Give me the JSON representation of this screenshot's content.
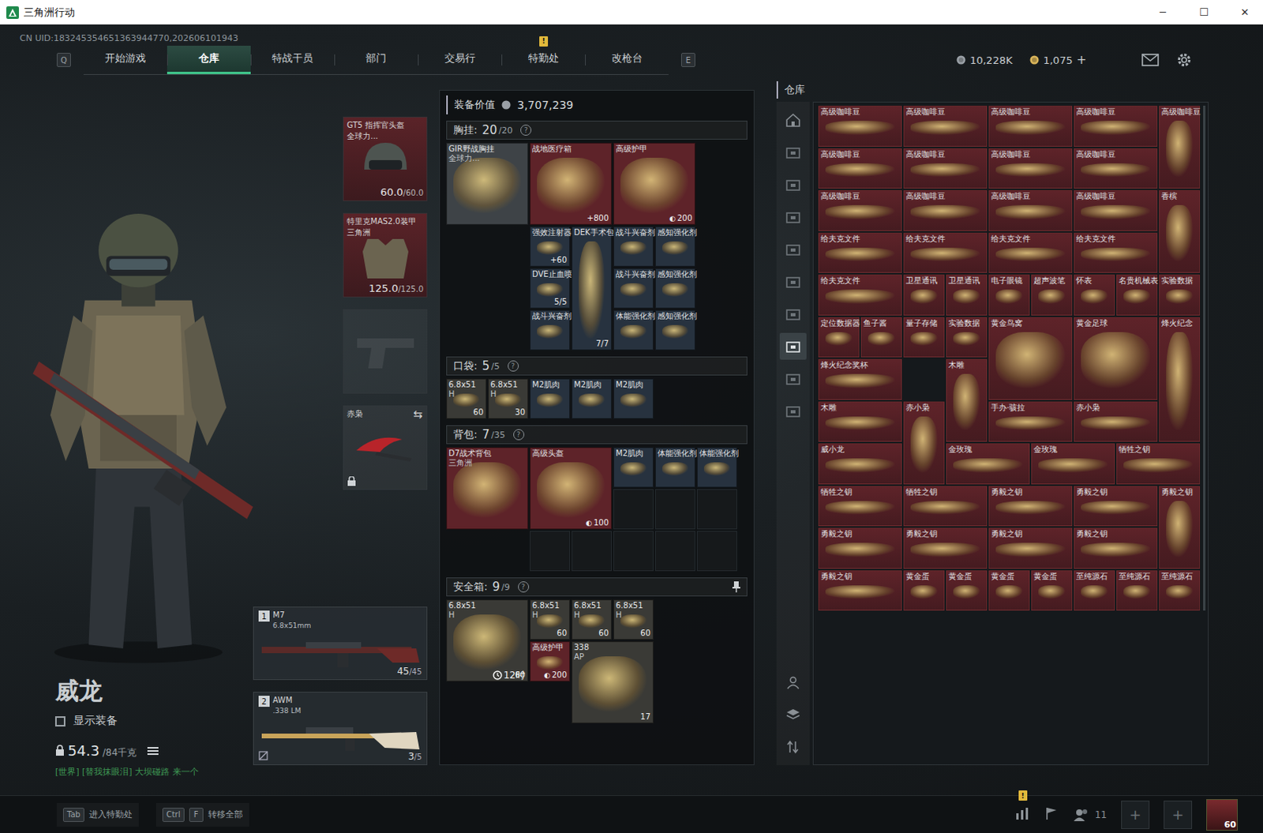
{
  "window": {
    "title": "三角洲行动",
    "controls": [
      "─",
      "☐",
      "✕"
    ]
  },
  "uid": "CN UID:183245354651363944770,202606101943",
  "nav": {
    "prev_key": "Q",
    "next_key": "E",
    "alert_mark": "!",
    "tabs": [
      {
        "label": "开始游戏",
        "selected": false,
        "alert": false
      },
      {
        "label": "仓库",
        "selected": true,
        "alert": false
      },
      {
        "label": "特战干员",
        "selected": false,
        "alert": false
      },
      {
        "label": "部门",
        "selected": false,
        "alert": false
      },
      {
        "label": "交易行",
        "selected": false,
        "alert": false
      },
      {
        "label": "特勤处",
        "selected": false,
        "alert": true
      },
      {
        "label": "改枪台",
        "selected": false,
        "alert": false
      }
    ]
  },
  "currencies": [
    {
      "value": "10,228K",
      "add": "",
      "color": "#9aa0a6"
    },
    {
      "value": "1,075",
      "add": "+",
      "color": "#d9b45a"
    }
  ],
  "operator": {
    "name": "威龙",
    "show_equipment": {
      "label": "显示装备",
      "checked": false
    },
    "weight": "54.3",
    "weight_max": "/84千克",
    "chat": "[世界] [替我抹眼泪] 大坝碰路 来一个"
  },
  "gear_slots": [
    {
      "kind": "helmet",
      "name": "GT5 指挥官头盔",
      "sub": "全球力...",
      "value": "60.0",
      "max": "/60.0"
    },
    {
      "kind": "armor",
      "name": "特里克MAS2.0装甲",
      "sub": "三角洲",
      "value": "125.0",
      "max": "/125.0"
    },
    {
      "kind": "pistol"
    },
    {
      "kind": "melee",
      "name": "赤枭",
      "swap": "⇆"
    }
  ],
  "weapons": [
    {
      "slot": "1",
      "name": "M7",
      "caliber": "6.8x51mm",
      "ammo": "45",
      "max": "/45"
    },
    {
      "slot": "2",
      "name": "AWM",
      "caliber": ".338 LM",
      "ammo": "3",
      "max": "/5"
    }
  ],
  "loadout": {
    "value_label": "装备价值",
    "value": "3,707,239",
    "help": "?",
    "chest": {
      "title": "胸挂:",
      "count": "20",
      "max": "/20",
      "items": [
        {
          "label": "GIR野战胸挂",
          "sub": "全球力...",
          "count": "",
          "color": "#3e4347"
        },
        {
          "label": "战地医疗箱",
          "sub": "",
          "count": "+800",
          "color": "#5e2329"
        },
        {
          "label": "高级护甲",
          "sub": "",
          "count": "200",
          "count_icon": "◐",
          "color": "#5e2329"
        },
        {
          "label": "强效注射器",
          "sub": "",
          "count": "+60",
          "color": "#27323f"
        },
        {
          "label": "DVE止血喷",
          "sub": "",
          "count": "5/5",
          "color": "#27323f"
        },
        {
          "label": "战斗兴奋剂",
          "sub": "",
          "count": "",
          "color": "#27323f"
        },
        {
          "label": "DEK手术包",
          "sub": "",
          "count": "7/7",
          "color": "#27323f"
        },
        {
          "label": "战斗兴奋剂",
          "sub": "",
          "count": "",
          "color": "#27323f"
        },
        {
          "label": "战斗兴奋剂",
          "sub": "",
          "count": "",
          "color": "#27323f"
        },
        {
          "label": "体能强化剂",
          "sub": "",
          "count": "",
          "color": "#27323f"
        },
        {
          "label": "感知强化剂",
          "sub": "",
          "count": "",
          "color": "#27323f"
        },
        {
          "label": "感知强化剂",
          "sub": "",
          "count": "",
          "color": "#27323f"
        },
        {
          "label": "感知强化剂",
          "sub": "",
          "count": "",
          "color": "#27323f"
        }
      ]
    },
    "pocket": {
      "title": "口袋:",
      "count": "5",
      "max": "/5",
      "items": [
        {
          "label": "6.8x51",
          "sub": "H",
          "count": "60",
          "color": "#3a3a36"
        },
        {
          "label": "6.8x51",
          "sub": "H",
          "count": "30",
          "color": "#3a3a36"
        },
        {
          "label": "M2肌肉",
          "sub": "",
          "count": "",
          "color": "#27323f"
        },
        {
          "label": "M2肌肉",
          "sub": "",
          "count": "",
          "color": "#27323f"
        },
        {
          "label": "M2肌肉",
          "sub": "",
          "count": "",
          "color": "#27323f"
        }
      ]
    },
    "backpack": {
      "title": "背包:",
      "count": "7",
      "max": "/35",
      "items": [
        {
          "label": "D7战术背包",
          "sub": "三角洲",
          "count": "",
          "color": "#5e2329"
        },
        {
          "label": "高级头盔",
          "sub": "",
          "count": "100",
          "count_icon": "◐",
          "color": "#5e2329"
        },
        {
          "label": "M2肌肉",
          "sub": "",
          "count": "",
          "color": "#27323f"
        },
        {
          "label": "体能强化剂",
          "sub": "",
          "count": "",
          "color": "#27323f"
        },
        {
          "label": "体能强化剂",
          "sub": "",
          "count": "",
          "color": "#27323f"
        }
      ]
    },
    "safebox": {
      "title": "安全箱:",
      "count": "9",
      "max": "/9",
      "timer": "12时",
      "items": [
        {
          "label": "6.8x51",
          "sub": "H",
          "count": "60",
          "color": "#3a3a36"
        },
        {
          "label": "6.8x51",
          "sub": "H",
          "count": "60",
          "color": "#3a3a36"
        },
        {
          "label": "6.8x51",
          "sub": "H",
          "count": "60",
          "color": "#3a3a36"
        },
        {
          "label": "6.8x51",
          "sub": "H",
          "count": "60",
          "color": "#3a3a36"
        },
        {
          "label": "高级护甲",
          "sub": "",
          "count": "200",
          "count_icon": "◐",
          "color": "#5e2329"
        },
        {
          "label": "338",
          "sub": "AP",
          "count": "17",
          "color": "#3a3a36"
        }
      ]
    }
  },
  "warehouse": {
    "title": "仓库",
    "side_tabs": [
      {
        "selected": false
      },
      {
        "selected": false
      },
      {
        "selected": false
      },
      {
        "selected": false
      },
      {
        "selected": false
      },
      {
        "selected": false
      },
      {
        "selected": false
      },
      {
        "selected": true
      },
      {
        "selected": false
      },
      {
        "selected": false
      }
    ],
    "items": [
      {
        "label": "高级咖啡豆"
      },
      {
        "label": "高级咖啡豆"
      },
      {
        "label": "高级咖啡豆"
      },
      {
        "label": "高级咖啡豆"
      },
      {
        "label": "高级咖啡豆"
      },
      {
        "label": "高级咖啡豆"
      },
      {
        "label": "高级咖啡豆"
      },
      {
        "label": "高级咖啡豆"
      },
      {
        "label": "高级咖啡豆"
      },
      {
        "label": "高级咖啡豆"
      },
      {
        "label": "高级咖啡豆"
      },
      {
        "label": "高级咖啡豆"
      },
      {
        "label": "高级咖啡豆"
      },
      {
        "label": "香槟"
      },
      {
        "label": "给夫克文件"
      },
      {
        "label": "给夫克文件"
      },
      {
        "label": "给夫克文件"
      },
      {
        "label": "给夫克文件"
      },
      {
        "label": "给夫克文件"
      },
      {
        "label": "卫星通讯"
      },
      {
        "label": "卫星通讯"
      },
      {
        "label": "电子眼镜"
      },
      {
        "label": "超声波笔"
      },
      {
        "label": "怀表"
      },
      {
        "label": "名贵机械表"
      },
      {
        "label": "实验数据"
      },
      {
        "label": "定位数据器"
      },
      {
        "label": "鱼子酱"
      },
      {
        "label": "量子存储"
      },
      {
        "label": "实验数据"
      },
      {
        "label": "黄金鸟窝"
      },
      {
        "label": "黄金足球"
      },
      {
        "label": "烽火纪念"
      },
      {
        "label": "烽火纪念奖杯"
      },
      {
        "label": "木雕"
      },
      {
        "label": "木雕"
      },
      {
        "label": "赤小枭"
      },
      {
        "label": "手办·骇拉"
      },
      {
        "label": "赤小枭"
      },
      {
        "label": "威小龙"
      },
      {
        "label": "金玫瑰"
      },
      {
        "label": "金玫瑰"
      },
      {
        "label": "牺牲之钥"
      },
      {
        "label": "牺牲之钥"
      },
      {
        "label": "牺牲之钥"
      },
      {
        "label": "勇毅之钥"
      },
      {
        "label": "勇毅之钥"
      },
      {
        "label": "勇毅之钥"
      },
      {
        "label": "勇毅之钥"
      },
      {
        "label": "勇毅之钥"
      },
      {
        "label": "勇毅之钥"
      },
      {
        "label": "勇毅之钥"
      },
      {
        "label": "勇毅之钥"
      },
      {
        "label": "黄金蛋"
      },
      {
        "label": "黄金蛋"
      },
      {
        "label": "黄金蛋"
      },
      {
        "label": "黄金蛋"
      },
      {
        "label": "至纯源石"
      },
      {
        "label": "至纯源石"
      },
      {
        "label": "至纯源石"
      }
    ]
  },
  "bottom_bar": {
    "hints": [
      {
        "keys": [
          "Tab"
        ],
        "label": "进入特勤处"
      },
      {
        "keys": [
          "Ctrl",
          "F"
        ],
        "label": "转移全部"
      }
    ],
    "alert_mark": "!",
    "friends": "11",
    "plus": [
      "+",
      "+"
    ],
    "level": "60"
  }
}
